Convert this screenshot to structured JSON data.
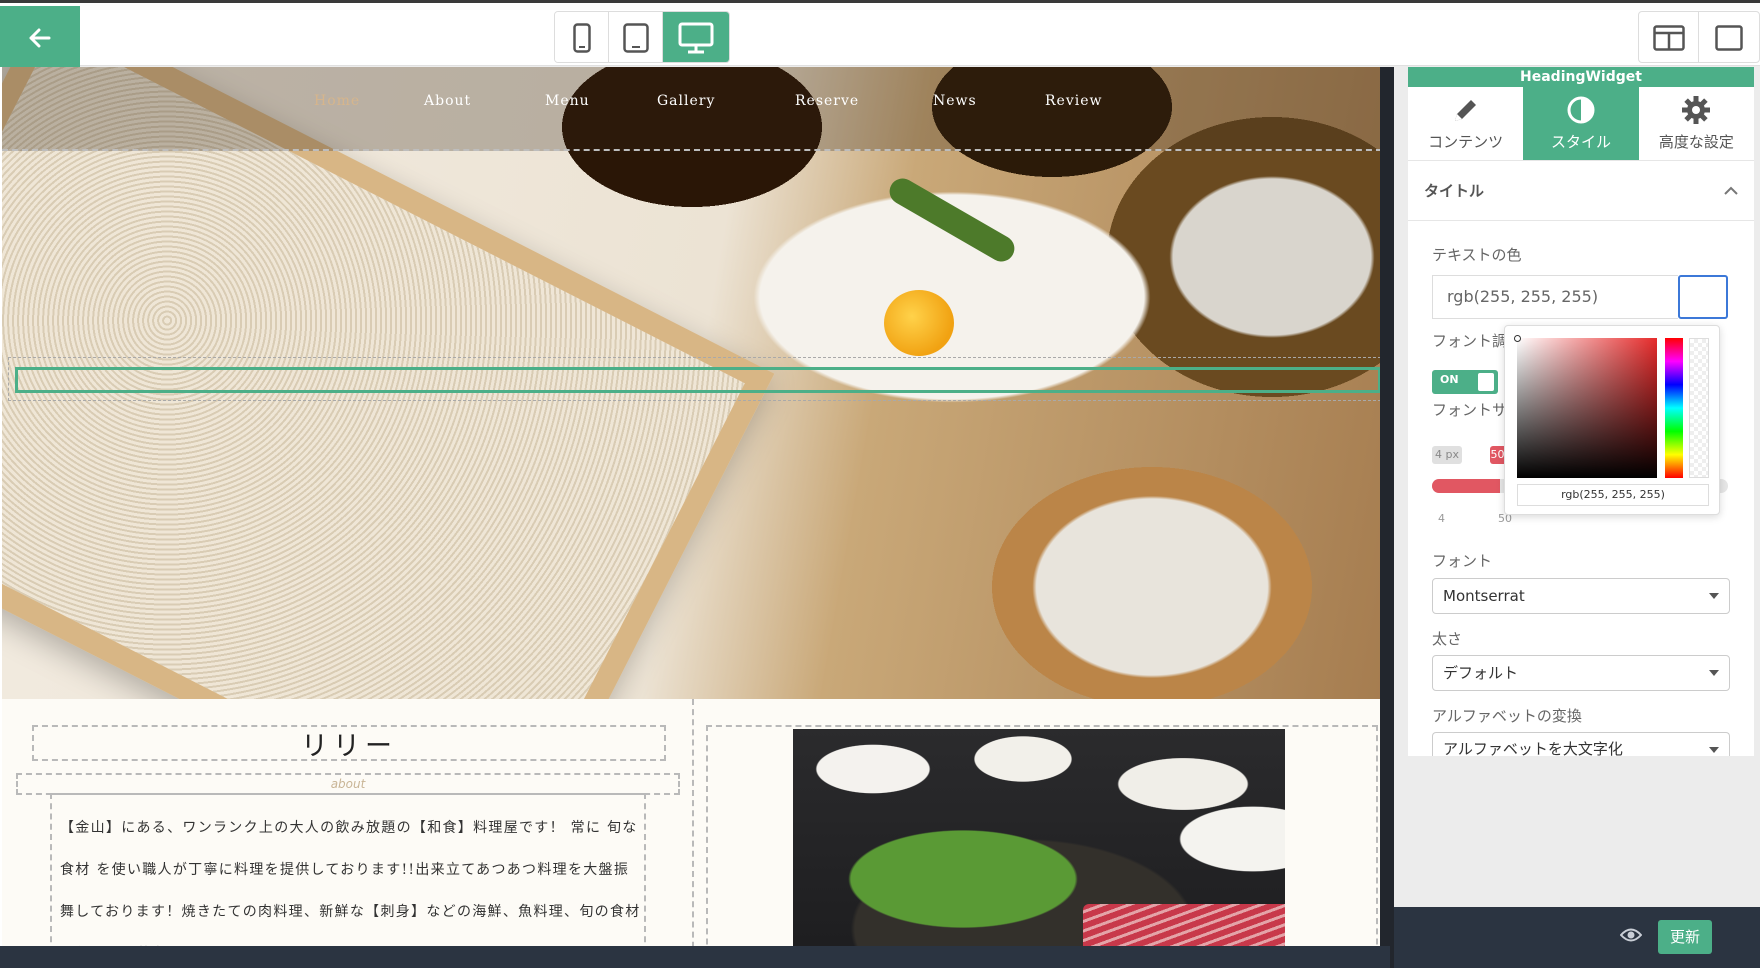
{
  "toolbar": {
    "back_icon": "arrow-left-icon",
    "devices": [
      {
        "icon": "phone-icon",
        "active": false
      },
      {
        "icon": "tablet-icon",
        "active": false
      },
      {
        "icon": "desktop-icon",
        "active": true
      }
    ],
    "layouts": [
      {
        "icon": "split-view-icon"
      },
      {
        "icon": "single-view-icon"
      }
    ]
  },
  "site": {
    "nav": [
      "Home",
      "About",
      "Menu",
      "Gallery",
      "Reserve",
      "News",
      "Review"
    ],
    "about_title": "リリー",
    "about_subtitle": "about",
    "about_body": "【金山】にある、ワンランク上の大人の飲み放題の【和食】料理屋です！ 常に 旬な食材 を使い職人が丁寧に料理を提供しております!!出来立てあつあつ料理を大盤振舞しております！焼きたての肉料理、新鮮な【刺身】などの海鮮、魚料理、旬の食材を使った【蒸煮】や【天ぷら】なども..."
  },
  "panel": {
    "widget_title": "HeadingWidget",
    "tabs": [
      {
        "label": "コンテンツ",
        "icon": "pencil-icon",
        "active": false
      },
      {
        "label": "スタイル",
        "icon": "contrast-icon",
        "active": true
      },
      {
        "label": "高度な設定",
        "icon": "gear-icon",
        "active": false
      }
    ],
    "section_title": "タイトル",
    "text_color_label": "テキストの色",
    "text_color_value": "rgb(255, 255, 255)",
    "font_adjust_label": "フォント調整",
    "font_adjust_state": "ON",
    "font_size_label": "フォントサイズ",
    "font_size_min": "4 px",
    "font_size_value": "50 px",
    "font_size_fraction": 0.23,
    "font_size_tick_min": "4",
    "font_size_tick_max": "50",
    "font_label": "フォント",
    "font_value": "Montserrat",
    "weight_label": "太さ",
    "weight_value": "デフォルト",
    "transform_label": "アルファベットの変換",
    "transform_value": "アルファベットを大文字化",
    "picker_value": "rgb(255, 255, 255)",
    "update_label": "更新"
  },
  "colors": {
    "accent": "#4caf88",
    "slider": "#e15762",
    "footer": "#2b3441"
  }
}
